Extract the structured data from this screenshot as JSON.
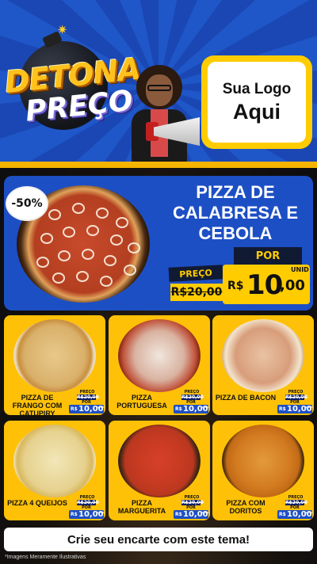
{
  "header": {
    "brand_line1": "DETONA",
    "brand_line2": "PREÇO",
    "logo_line1": "Sua Logo",
    "logo_line2": "Aqui"
  },
  "featured": {
    "discount": "-50%",
    "title": "PIZZA DE CALABRESA E CEBOLA",
    "preco_label": "PREÇO",
    "old_price": "R$20,00",
    "por_label": "POR",
    "currency": "R$",
    "price_int": "10",
    "price_dec": ",00",
    "unit": "UNID"
  },
  "products": [
    {
      "name": "PIZZA DE FRANGO COM CATUPIRY",
      "preco_label": "PREÇO",
      "old_price": "R$20,00",
      "por_label": "POR",
      "currency": "R$",
      "price": "10,00",
      "unit": "UNID"
    },
    {
      "name": "PIZZA PORTUGUESA",
      "preco_label": "PREÇO",
      "old_price": "R$20,00",
      "por_label": "POR",
      "currency": "R$",
      "price": "10,00",
      "unit": "UNID"
    },
    {
      "name": "PIZZA DE BACON",
      "preco_label": "PREÇO",
      "old_price": "R$20,00",
      "por_label": "POR",
      "currency": "R$",
      "price": "10,00",
      "unit": "UNID"
    },
    {
      "name": "PIZZA 4 QUEIJOS",
      "preco_label": "PREÇO",
      "old_price": "R$20,00",
      "por_label": "POR",
      "currency": "R$",
      "price": "10,00",
      "unit": "UNID"
    },
    {
      "name": "PIZZA MARGUERITA",
      "preco_label": "PREÇO",
      "old_price": "R$20,00",
      "por_label": "POR",
      "currency": "R$",
      "price": "10,00",
      "unit": "UNID"
    },
    {
      "name": "PIZZA COM DORITOS",
      "preco_label": "PREÇO",
      "old_price": "R$20,00",
      "por_label": "POR",
      "currency": "R$",
      "price": "10,00",
      "unit": "UNID"
    }
  ],
  "footer": {
    "cta": "Crie seu encarte com este tema!",
    "disclaimer": "*Imagens Meramente Ilustrativas"
  },
  "colors": {
    "brand_blue": "#1d4fc4",
    "brand_yellow": "#ffc107",
    "navy": "#111a33"
  },
  "icons": [
    "bomb-icon",
    "megaphone-icon",
    "pizza-image"
  ]
}
